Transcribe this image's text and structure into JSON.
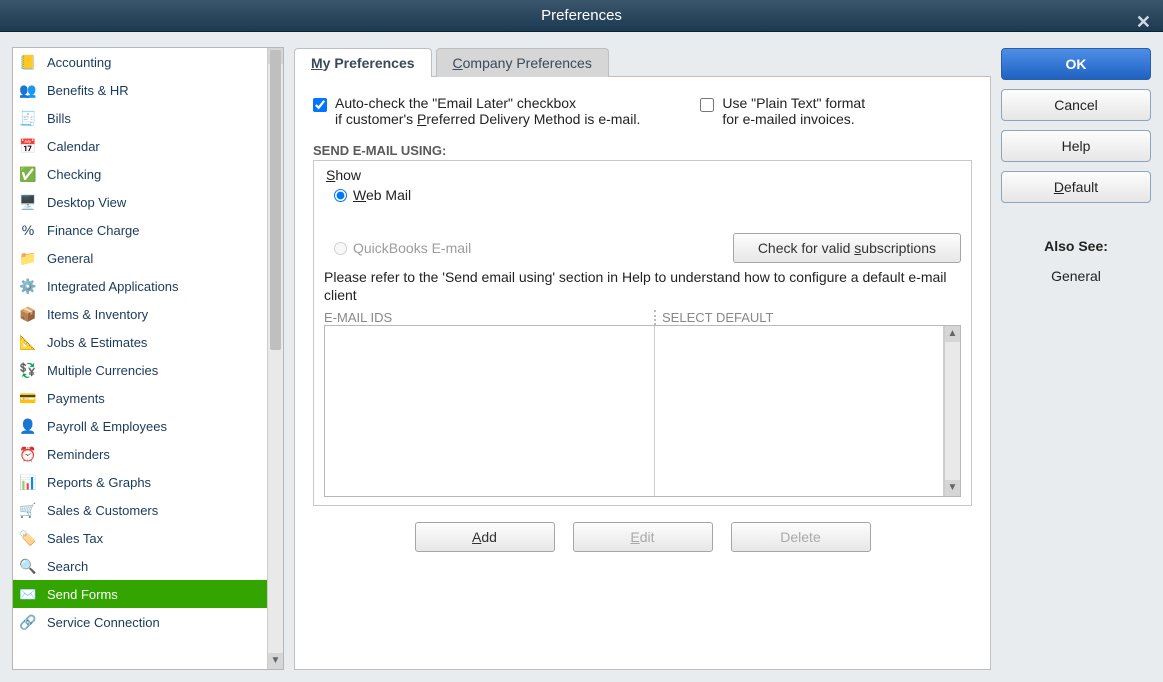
{
  "dialog": {
    "title": "Preferences"
  },
  "sidebar": {
    "items": [
      {
        "label": "Accounting",
        "icon": "📒"
      },
      {
        "label": "Benefits & HR",
        "icon": "👥"
      },
      {
        "label": "Bills",
        "icon": "🧾"
      },
      {
        "label": "Calendar",
        "icon": "📅"
      },
      {
        "label": "Checking",
        "icon": "✅"
      },
      {
        "label": "Desktop View",
        "icon": "🖥️"
      },
      {
        "label": "Finance Charge",
        "icon": "%"
      },
      {
        "label": "General",
        "icon": "📁"
      },
      {
        "label": "Integrated Applications",
        "icon": "⚙️"
      },
      {
        "label": "Items & Inventory",
        "icon": "📦"
      },
      {
        "label": "Jobs & Estimates",
        "icon": "📐"
      },
      {
        "label": "Multiple Currencies",
        "icon": "💱"
      },
      {
        "label": "Payments",
        "icon": "💳"
      },
      {
        "label": "Payroll & Employees",
        "icon": "👤"
      },
      {
        "label": "Reminders",
        "icon": "⏰"
      },
      {
        "label": "Reports & Graphs",
        "icon": "📊"
      },
      {
        "label": "Sales & Customers",
        "icon": "🛒"
      },
      {
        "label": "Sales Tax",
        "icon": "🏷️"
      },
      {
        "label": "Search",
        "icon": "🔍"
      },
      {
        "label": "Send Forms",
        "icon": "✉️",
        "selected": true
      },
      {
        "label": "Service Connection",
        "icon": "🔗"
      }
    ]
  },
  "tabs": {
    "my": "My Preferences",
    "company": "Company Preferences",
    "active": "my"
  },
  "checkboxes": {
    "autoEmail": {
      "checked": true,
      "line1": "Auto-check the \"Email Later\" checkbox",
      "line2": "if customer's Preferred Delivery Method is e-mail."
    },
    "plainText": {
      "checked": false,
      "line1": "Use \"Plain Text\" format",
      "line2": "for e-mailed invoices."
    }
  },
  "sendEmail": {
    "heading": "SEND E-MAIL USING:",
    "showLabel": "Show",
    "options": [
      {
        "label": "Web Mail",
        "checked": true,
        "enabled": true
      },
      {
        "label": "QuickBooks E-mail",
        "checked": false,
        "enabled": false
      }
    ],
    "checkSub": "Check for valid subscriptions",
    "help": "Please refer to the 'Send email using' section in Help to understand how to configure a default e-mail client",
    "col1": "E-MAIL IDS",
    "col2": "SELECT DEFAULT"
  },
  "listButtons": {
    "add": "Add",
    "edit": "Edit",
    "delete": "Delete"
  },
  "rightButtons": {
    "ok": "OK",
    "cancel": "Cancel",
    "help": "Help",
    "default": "Default"
  },
  "alsoSee": {
    "heading": "Also See:",
    "link": "General"
  }
}
